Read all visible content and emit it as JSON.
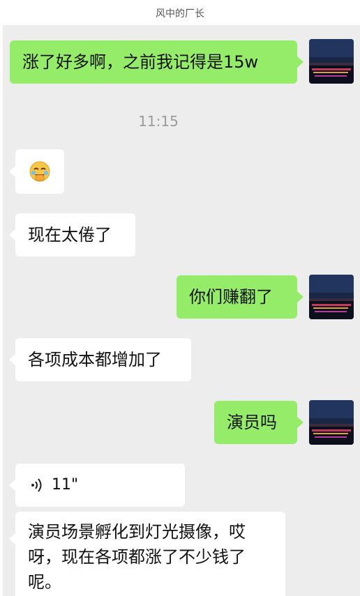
{
  "header": {
    "title": "风中的厂长"
  },
  "messages": {
    "m1": "涨了好多啊，之前我记得是15w",
    "time": "11:15",
    "m3": "现在太倦了",
    "m4": "你们赚翻了",
    "m5": "各项成本都增加了",
    "m6": "演员吗",
    "voice_duration": "11\"",
    "m8": "演员场景孵化到灯光摄像，哎呀，现在各项都涨了不少钱了呢。"
  },
  "icons": {
    "emoji": "face-with-hand-over-mouth-laugh-emoji",
    "voice": "voice-wave-icon",
    "avatar": "night-city-skyline-avatar"
  },
  "colors": {
    "outgoing_bubble": "#95ec69",
    "incoming_bubble": "#ffffff",
    "chat_background": "#ededed"
  }
}
